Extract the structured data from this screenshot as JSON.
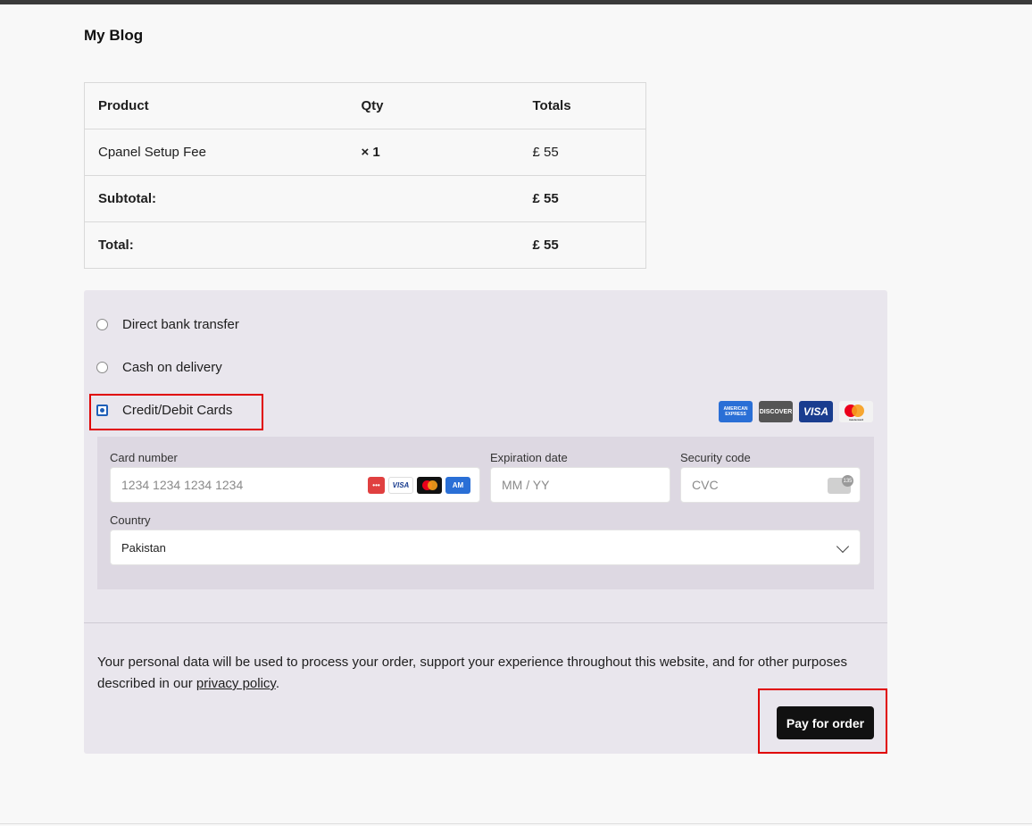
{
  "site": {
    "title": "My Blog"
  },
  "order_table": {
    "headers": [
      "Product",
      "Qty",
      "Totals"
    ],
    "rows": [
      {
        "product": "Cpanel Setup Fee",
        "qty": "× 1",
        "total": "£ 55"
      }
    ],
    "subtotal_label": "Subtotal:",
    "subtotal_value": "£ 55",
    "total_label": "Total:",
    "total_value": "£ 55"
  },
  "payment_methods": [
    {
      "label": "Direct bank transfer",
      "selected": false
    },
    {
      "label": "Cash on delivery",
      "selected": false
    },
    {
      "label": "Credit/Debit Cards",
      "selected": true
    }
  ],
  "card_brands": [
    "AMERICAN EXPRESS",
    "DISCOVER",
    "VISA",
    "mastercard"
  ],
  "card_form": {
    "card_number_label": "Card number",
    "card_number_placeholder": "1234 1234 1234 1234",
    "expiry_label": "Expiration date",
    "expiry_placeholder": "MM / YY",
    "security_label": "Security code",
    "security_placeholder": "CVC",
    "cvc_icon_text": "135",
    "country_label": "Country",
    "country_value": "Pakistan"
  },
  "privacy": {
    "text": "Your personal data will be used to process your order, support your experience throughout this website, and for other purposes described in our ",
    "link_text": "privacy policy",
    "suffix": "."
  },
  "pay_button": {
    "label": "Pay for order"
  },
  "colors": {
    "accent": "#1f5fb8",
    "highlight": "#e00000",
    "button_bg": "#111111",
    "payment_bg": "#e9e6ed"
  }
}
